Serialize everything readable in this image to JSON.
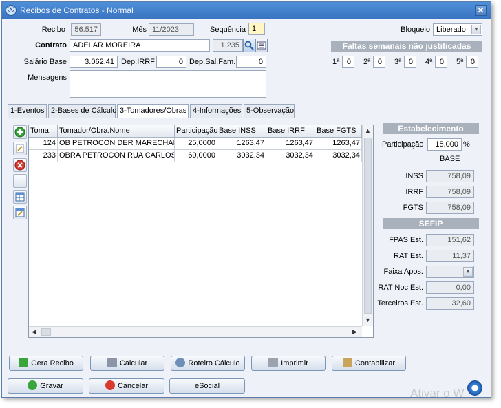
{
  "window": {
    "title": "Recibos de Contratos - Normal",
    "close_label": "✕",
    "app_icon": "ⓢ"
  },
  "header": {
    "recibo_label": "Recibo",
    "recibo_value": "56.517",
    "mes_label": "Mês",
    "mes_value": "11/2023",
    "sequencia_label": "Sequência",
    "sequencia_value": "1",
    "bloqueio_label": "Bloqueio",
    "bloqueio_value": "Liberado",
    "contrato_label": "Contrato",
    "contrato_value": "ADELAR MOREIRA",
    "contrato_code": "1.235",
    "salario_label": "Salário Base",
    "salario_value": "3.062,41",
    "depirrf_label": "Dep.IRRF",
    "depirrf_value": "0",
    "depsalfam_label": "Dep.Sal.Fam.",
    "depsalfam_value": "0",
    "mensagens_label": "Mensagens",
    "mensagens_value": ""
  },
  "faltas": {
    "title": "Faltas semanais não justificadas",
    "weeks": [
      {
        "label": "1ª",
        "value": "0"
      },
      {
        "label": "2ª",
        "value": "0"
      },
      {
        "label": "3ª",
        "value": "0"
      },
      {
        "label": "4ª",
        "value": "0"
      },
      {
        "label": "5ª",
        "value": "0"
      }
    ]
  },
  "tabs": [
    {
      "label": "1-Eventos"
    },
    {
      "label": "2-Bases de Cálculo"
    },
    {
      "label": "3-Tomadores/Obras"
    },
    {
      "label": "4-Informações"
    },
    {
      "label": "5-Observação"
    }
  ],
  "grid": {
    "columns": [
      "Toma...",
      "Tomador/Obra.Nome",
      "Participação",
      "Base INSS",
      "Base IRRF",
      "Base FGTS"
    ],
    "rows": [
      [
        "124",
        "OB PETROCON DER MARECHAL CA",
        "25,0000",
        "1263,47",
        "1263,47",
        "1263,47"
      ],
      [
        "233",
        "OBRA PETROCON RUA CARLOS GC",
        "60,0000",
        "3032,34",
        "3032,34",
        "3032,34"
      ]
    ]
  },
  "estabelecimento": {
    "title": "Estabelecimento",
    "participacao_label": "Participação",
    "participacao_value": "15,000",
    "participacao_unit": "%",
    "base_label": "BASE",
    "inss_label": "INSS",
    "inss_value": "758,09",
    "irrf_label": "IRRF",
    "irrf_value": "758,09",
    "fgts_label": "FGTS",
    "fgts_value": "758,09"
  },
  "sefip": {
    "title": "SEFIP",
    "fpas_label": "FPAS Est.",
    "fpas_value": "151,62",
    "rat_label": "RAT Est.",
    "rat_value": "11,37",
    "faixa_label": "Faixa Apos.",
    "faixa_value": "",
    "ratnoc_label": "RAT Noc.Est.",
    "ratnoc_value": "0,00",
    "terceiros_label": "Terceiros Est.",
    "terceiros_value": "32,60"
  },
  "buttons": {
    "gera_recibo": "Gera Recibo",
    "calcular": "Calcular",
    "roteiro": "Roteiro Cálculo",
    "imprimir": "Imprimir",
    "contabilizar": "Contabilizar",
    "gravar": "Gravar",
    "cancelar": "Cancelar",
    "esocial": "eSocial"
  },
  "watermark": "Ativar o W",
  "colors": {
    "title_bar": "#3f7ecb",
    "section_bar": "#a9b1bc",
    "window_bg": "#eef2f8"
  }
}
